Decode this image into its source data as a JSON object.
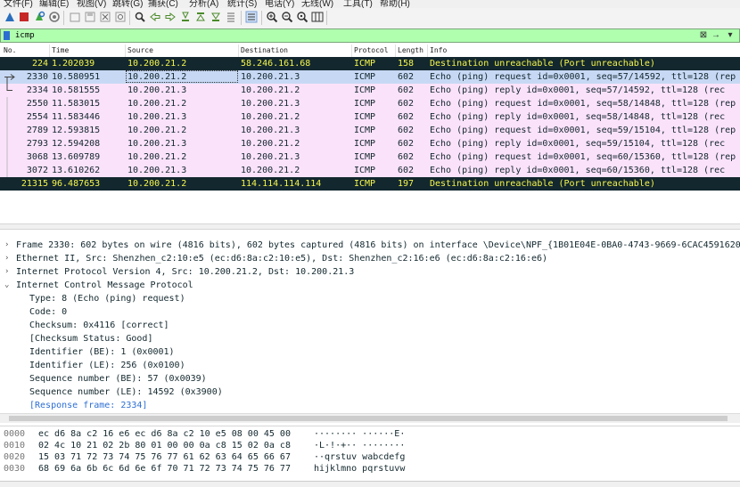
{
  "menu": [
    "文件(F)",
    "编辑(E)",
    "视图(V)",
    "跳转(G)",
    "捕获(C)",
    "分析(A)",
    "统计(S)",
    "电话(Y)",
    "无线(W)",
    "工具(T)",
    "帮助(H)"
  ],
  "toolbar": {
    "icons": [
      "shark-fin-start-icon",
      "stop-capture-icon",
      "restart-capture-icon",
      "capture-options-icon",
      "open-file-icon",
      "save-file-icon",
      "close-file-icon",
      "reload-file-icon",
      "find-packet-icon",
      "go-back-icon",
      "go-forward-icon",
      "go-to-packet-icon",
      "first-packet-icon",
      "last-packet-icon",
      "auto-scroll-icon",
      "colorize-icon",
      "zoom-in-icon",
      "zoom-out-icon",
      "normal-size-icon",
      "resize-columns-icon"
    ],
    "colors": {
      "stop": "#c62828",
      "start": "#2a6ebd",
      "restart": "#3fa83f"
    }
  },
  "filter": {
    "value": "icmp",
    "bg": "#afffaf"
  },
  "columns": [
    "No.",
    "Time",
    "Source",
    "Destination",
    "Protocol",
    "Length",
    "Info"
  ],
  "packets": [
    {
      "no": "224",
      "time": "1.202039",
      "src": "10.200.21.2",
      "dst": "58.246.161.68",
      "proto": "ICMP",
      "len": "158",
      "info": "Destination unreachable (Port unreachable)",
      "style": "err"
    },
    {
      "no": "2330",
      "time": "10.580951",
      "src": "10.200.21.2",
      "dst": "10.200.21.3",
      "proto": "ICMP",
      "len": "602",
      "info": "Echo (ping) request  id=0x0001, seq=57/14592, ttl=128 (rep",
      "style": "sel"
    },
    {
      "no": "2334",
      "time": "10.581555",
      "src": "10.200.21.3",
      "dst": "10.200.21.2",
      "proto": "ICMP",
      "len": "602",
      "info": "Echo (ping) reply    id=0x0001, seq=57/14592, ttl=128 (rec",
      "style": "req"
    },
    {
      "no": "2550",
      "time": "11.583015",
      "src": "10.200.21.2",
      "dst": "10.200.21.3",
      "proto": "ICMP",
      "len": "602",
      "info": "Echo (ping) request  id=0x0001, seq=58/14848, ttl=128 (rep",
      "style": "req"
    },
    {
      "no": "2554",
      "time": "11.583446",
      "src": "10.200.21.3",
      "dst": "10.200.21.2",
      "proto": "ICMP",
      "len": "602",
      "info": "Echo (ping) reply    id=0x0001, seq=58/14848, ttl=128 (rec",
      "style": "req"
    },
    {
      "no": "2789",
      "time": "12.593815",
      "src": "10.200.21.2",
      "dst": "10.200.21.3",
      "proto": "ICMP",
      "len": "602",
      "info": "Echo (ping) request  id=0x0001, seq=59/15104, ttl=128 (rep",
      "style": "req"
    },
    {
      "no": "2793",
      "time": "12.594208",
      "src": "10.200.21.3",
      "dst": "10.200.21.2",
      "proto": "ICMP",
      "len": "602",
      "info": "Echo (ping) reply    id=0x0001, seq=59/15104, ttl=128 (rec",
      "style": "req"
    },
    {
      "no": "3068",
      "time": "13.609789",
      "src": "10.200.21.2",
      "dst": "10.200.21.3",
      "proto": "ICMP",
      "len": "602",
      "info": "Echo (ping) request  id=0x0001, seq=60/15360, ttl=128 (rep",
      "style": "req"
    },
    {
      "no": "3072",
      "time": "13.610262",
      "src": "10.200.21.3",
      "dst": "10.200.21.2",
      "proto": "ICMP",
      "len": "602",
      "info": "Echo (ping) reply    id=0x0001, seq=60/15360, ttl=128 (rec",
      "style": "req"
    },
    {
      "no": "21315",
      "time": "96.487653",
      "src": "10.200.21.2",
      "dst": "114.114.114.114",
      "proto": "ICMP",
      "len": "197",
      "info": "Destination unreachable (Port unreachable)",
      "style": "err"
    }
  ],
  "details": [
    {
      "text": "Frame 2330: 602 bytes on wire (4816 bits), 602 bytes captured (4816 bits) on interface \\Device\\NPF_{1B01E04E-0BA0-4743-9669-6CAC4591620",
      "expanded": false,
      "child": false
    },
    {
      "text": "Ethernet II, Src: Shenzhen_c2:10:e5 (ec:d6:8a:c2:10:e5), Dst: Shenzhen_c2:16:e6 (ec:d6:8a:c2:16:e6)",
      "expanded": false,
      "child": false
    },
    {
      "text": "Internet Protocol Version 4, Src: 10.200.21.2, Dst: 10.200.21.3",
      "expanded": false,
      "child": false
    },
    {
      "text": "Internet Control Message Protocol",
      "expanded": true,
      "child": false
    },
    {
      "text": "Type: 8 (Echo (ping) request)",
      "child": true
    },
    {
      "text": "Code: 0",
      "child": true
    },
    {
      "text": "Checksum: 0x4116 [correct]",
      "child": true
    },
    {
      "text": "[Checksum Status: Good]",
      "child": true
    },
    {
      "text": "Identifier (BE): 1 (0x0001)",
      "child": true
    },
    {
      "text": "Identifier (LE): 256 (0x0100)",
      "child": true
    },
    {
      "text": "Sequence number (BE): 57 (0x0039)",
      "child": true
    },
    {
      "text": "Sequence number (LE): 14592 (0x3900)",
      "child": true
    },
    {
      "text": "[Response frame: 2334]",
      "child": true,
      "link": true
    }
  ],
  "bytes": [
    {
      "off": "0000",
      "hex": "ec d6 8a c2 16 e6 ec d6  8a c2 10 e5 08 00 45 00",
      "asc": "········ ······E·"
    },
    {
      "off": "0010",
      "hex": "02 4c 10 21 02 2b 80 01  00 00 0a c8 15 02 0a c8",
      "asc": "·L·!·+·· ········"
    },
    {
      "off": "0020",
      "hex": "15 03 71 72 73 74 75 76  77 61 62 63 64 65 66 67",
      "asc": "··qrstuv wabcdefg"
    },
    {
      "off": "0030",
      "hex": "68 69 6a 6b 6c 6d 6e 6f  70 71 72 73 74 75 76 77",
      "asc": "hijklmno pqrstuvw"
    }
  ]
}
